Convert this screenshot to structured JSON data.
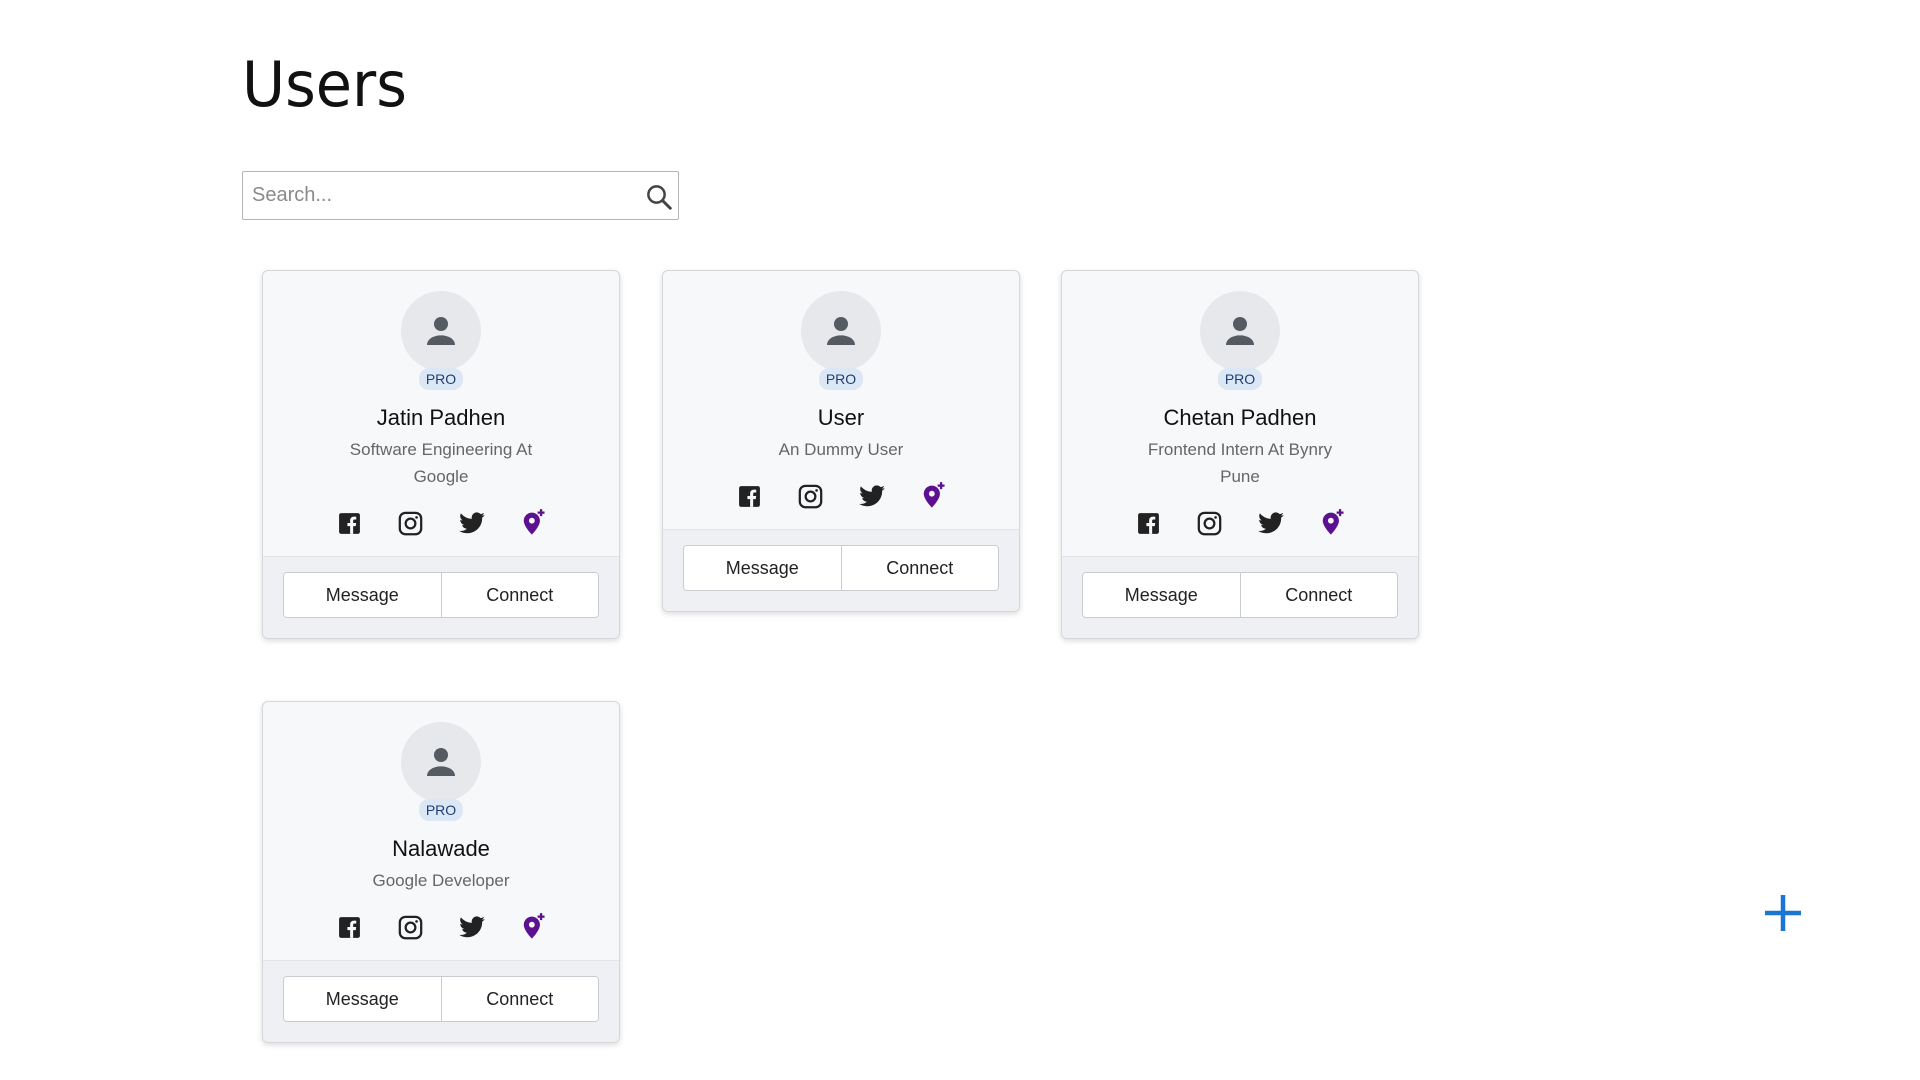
{
  "page": {
    "title": "Users"
  },
  "search": {
    "placeholder": "Search..."
  },
  "colors": {
    "accent": "#1976d2",
    "pin": "#5b1190",
    "badge_bg": "#dbe7f5",
    "badge_text": "#1f3f73"
  },
  "cards": [
    {
      "name": "Jatin Padhen",
      "description": "Software Engineering At Google",
      "badge": "PRO",
      "message_label": "Message",
      "connect_label": "Connect"
    },
    {
      "name": "User",
      "description": "An Dummy User",
      "badge": "PRO",
      "message_label": "Message",
      "connect_label": "Connect"
    },
    {
      "name": "Chetan Padhen",
      "description": "Frontend Intern At Bynry Pune",
      "badge": "PRO",
      "message_label": "Message",
      "connect_label": "Connect"
    },
    {
      "name": "Nalawade",
      "description": "Google Developer",
      "badge": "PRO",
      "message_label": "Message",
      "connect_label": "Connect"
    }
  ],
  "icons": {
    "avatar": "user-icon",
    "socials": [
      "facebook-icon",
      "instagram-icon",
      "twitter-icon",
      "location-add-icon"
    ],
    "search": "search-icon",
    "fab": "plus-icon"
  }
}
